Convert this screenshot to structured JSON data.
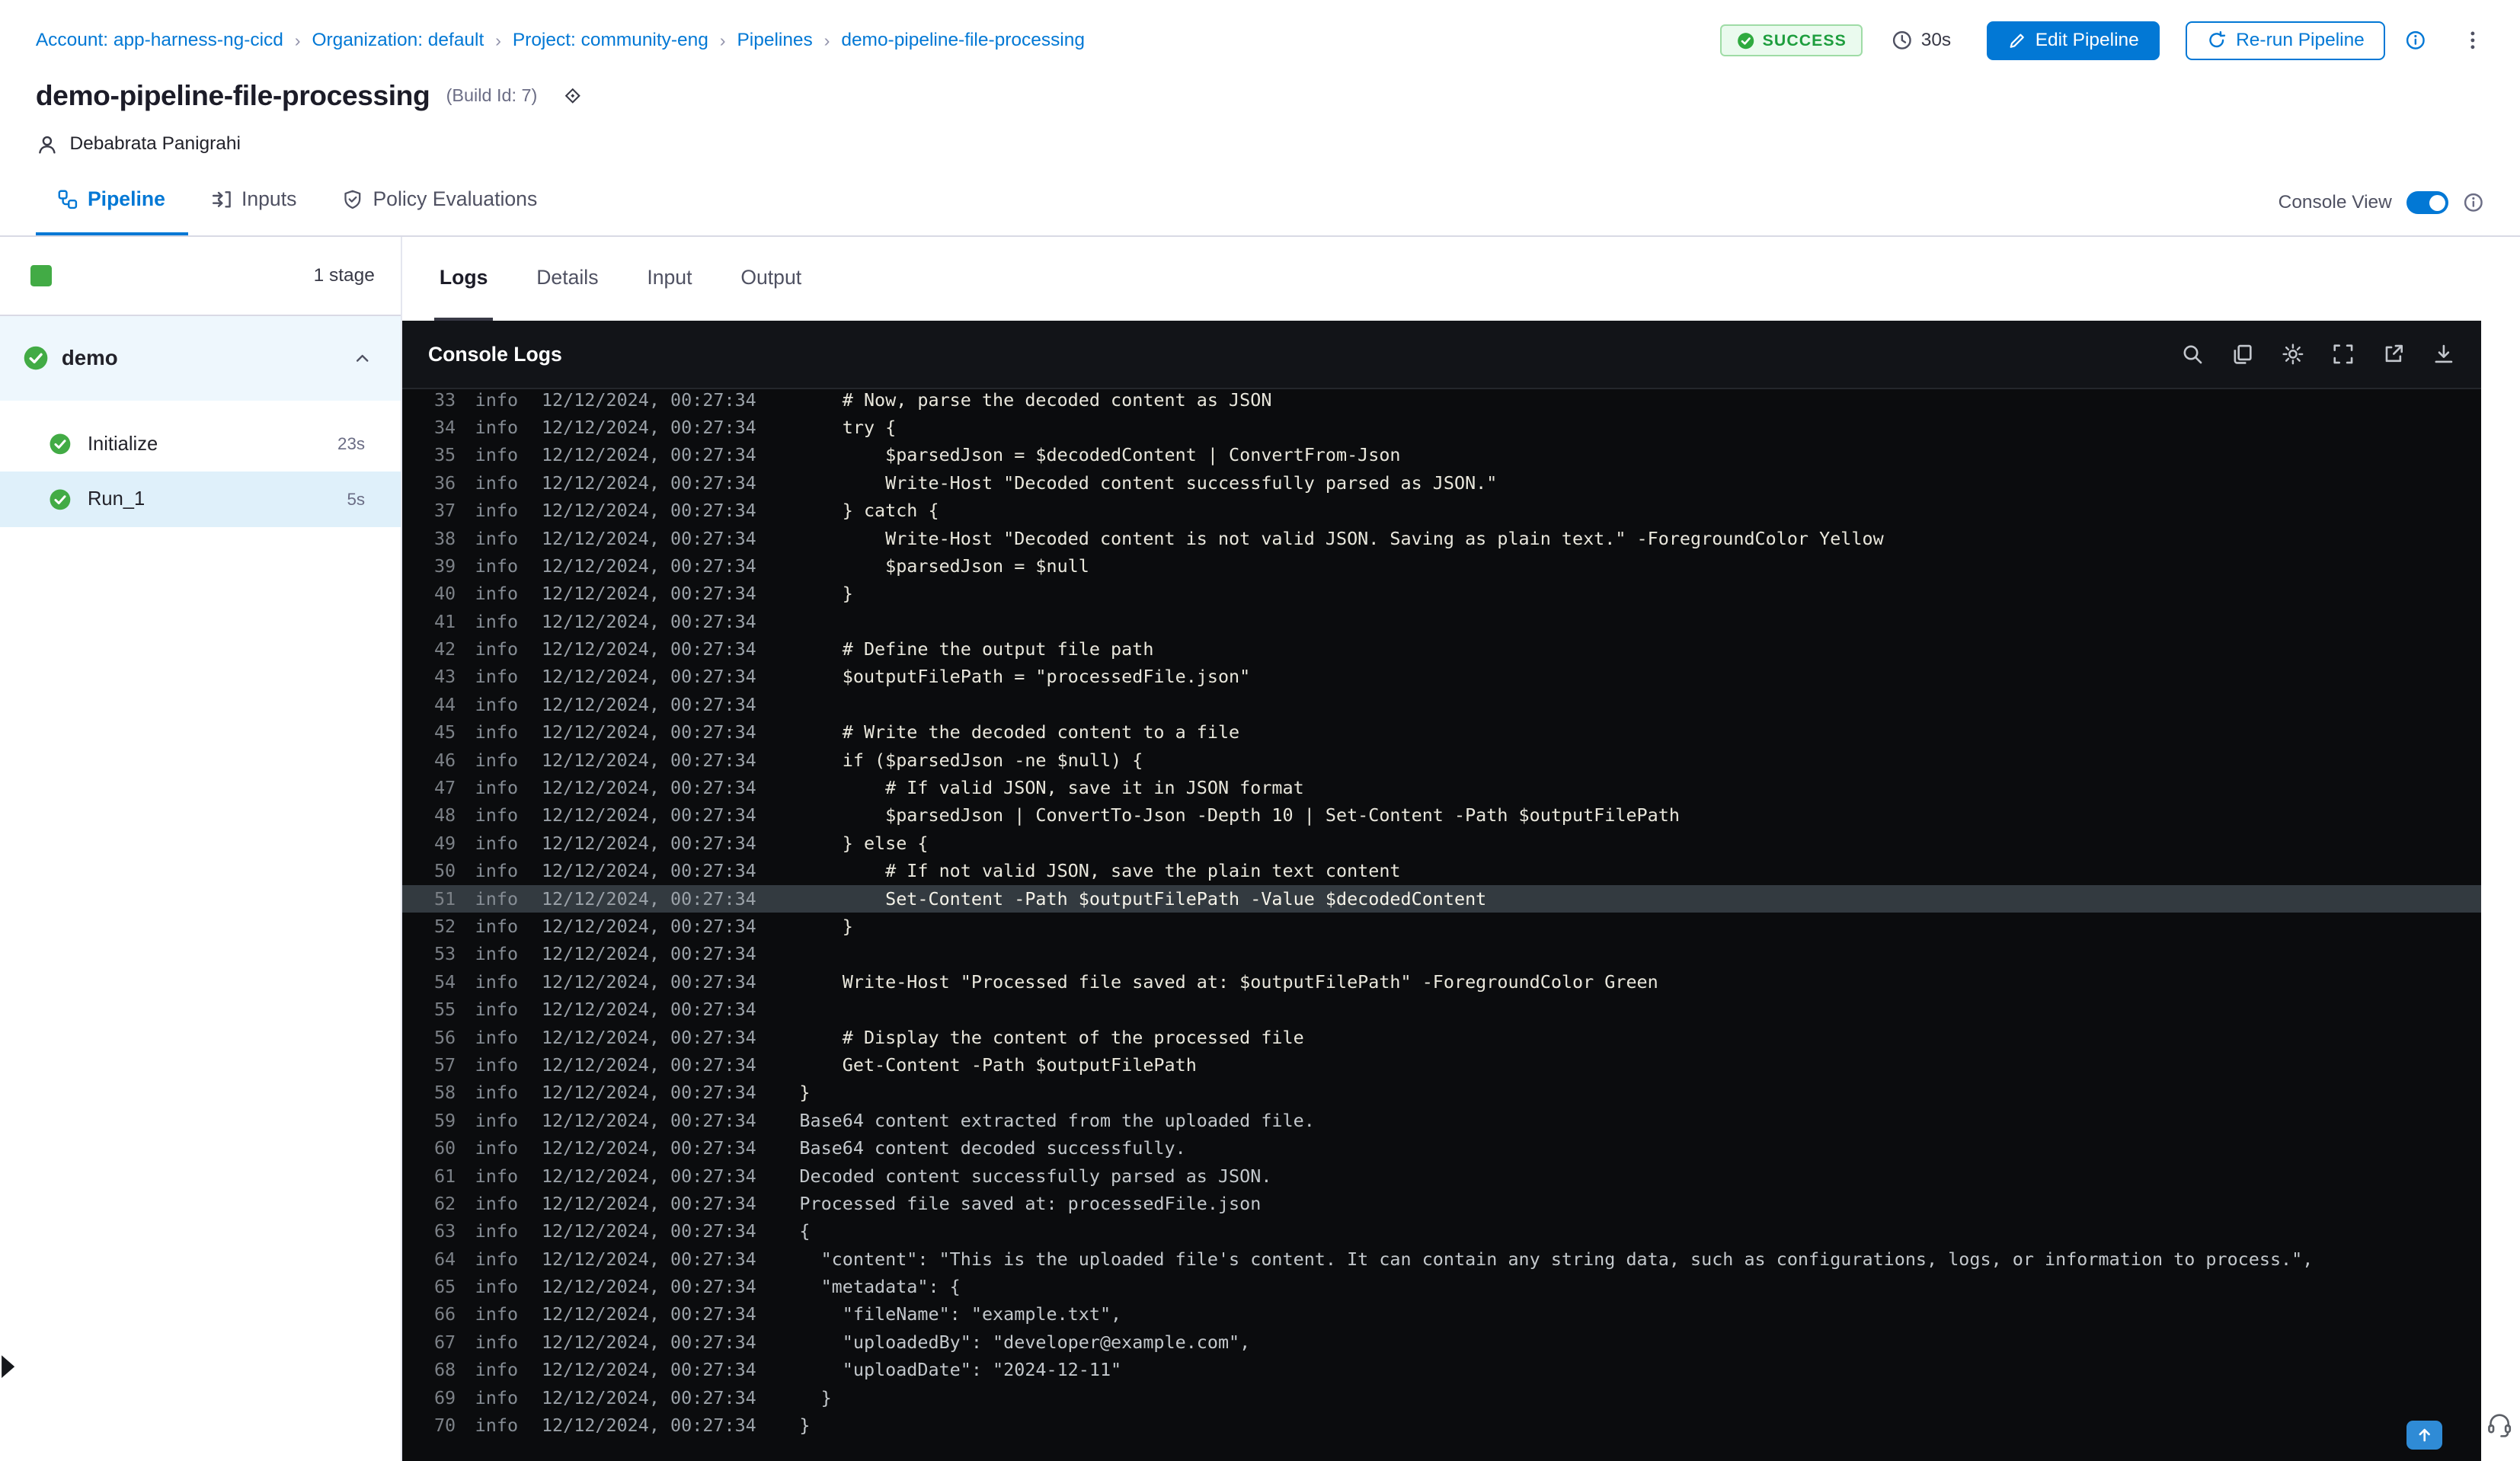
{
  "colors": {
    "accent": "#0278d5",
    "success_green": "#42ab45",
    "console_bg": "#0b0c0e",
    "highlight_row": "#333a40"
  },
  "breadcrumb": {
    "separator": "›",
    "items": [
      "Account: app-harness-ng-cicd",
      "Organization: default",
      "Project: community-eng",
      "Pipelines",
      "demo-pipeline-file-processing"
    ]
  },
  "header": {
    "status": "SUCCESS",
    "duration": "30s",
    "edit_button": "Edit Pipeline",
    "rerun_button": "Re-run Pipeline",
    "title": "demo-pipeline-file-processing",
    "build_id": "(Build Id: 7)",
    "user": "Debabrata Panigrahi"
  },
  "nav_tabs": {
    "items": [
      {
        "label": "Pipeline",
        "active": true
      },
      {
        "label": "Inputs",
        "active": false
      },
      {
        "label": "Policy Evaluations",
        "active": false
      }
    ],
    "console_view_label": "Console View",
    "console_view_on": true
  },
  "sidebar": {
    "stage_count": "1 stage",
    "stage_group": "demo",
    "steps": [
      {
        "name": "Initialize",
        "duration": "23s",
        "selected": false
      },
      {
        "name": "Run_1",
        "duration": "5s",
        "selected": true
      }
    ]
  },
  "log_panel": {
    "tabs": [
      "Logs",
      "Details",
      "Input",
      "Output"
    ],
    "active_tab": "Logs",
    "console_title": "Console Logs",
    "level": "info",
    "timestamp": "12/12/2024, 00:27:34",
    "lines": [
      {
        "n": 33,
        "kind": "script",
        "text": "    # Now, parse the decoded content as JSON"
      },
      {
        "n": 34,
        "kind": "script",
        "text": "    try {"
      },
      {
        "n": 35,
        "kind": "script",
        "text": "        $parsedJson = $decodedContent | ConvertFrom-Json"
      },
      {
        "n": 36,
        "kind": "script",
        "text": "        Write-Host \"Decoded content successfully parsed as JSON.\""
      },
      {
        "n": 37,
        "kind": "script",
        "text": "    } catch {"
      },
      {
        "n": 38,
        "kind": "script",
        "text": "        Write-Host \"Decoded content is not valid JSON. Saving as plain text.\" -ForegroundColor Yellow"
      },
      {
        "n": 39,
        "kind": "script",
        "text": "        $parsedJson = $null"
      },
      {
        "n": 40,
        "kind": "script",
        "text": "    }"
      },
      {
        "n": 41,
        "kind": "script",
        "text": ""
      },
      {
        "n": 42,
        "kind": "script",
        "text": "    # Define the output file path"
      },
      {
        "n": 43,
        "kind": "script",
        "text": "    $outputFilePath = \"processedFile.json\""
      },
      {
        "n": 44,
        "kind": "script",
        "text": ""
      },
      {
        "n": 45,
        "kind": "script",
        "text": "    # Write the decoded content to a file"
      },
      {
        "n": 46,
        "kind": "script",
        "text": "    if ($parsedJson -ne $null) {"
      },
      {
        "n": 47,
        "kind": "script",
        "text": "        # If valid JSON, save it in JSON format"
      },
      {
        "n": 48,
        "kind": "script",
        "text": "        $parsedJson | ConvertTo-Json -Depth 10 | Set-Content -Path $outputFilePath"
      },
      {
        "n": 49,
        "kind": "script",
        "text": "    } else {"
      },
      {
        "n": 50,
        "kind": "script",
        "text": "        # If not valid JSON, save the plain text content"
      },
      {
        "n": 51,
        "kind": "script",
        "highlight": true,
        "text": "        Set-Content -Path $outputFilePath -Value $decodedContent"
      },
      {
        "n": 52,
        "kind": "script",
        "text": "    }"
      },
      {
        "n": 53,
        "kind": "script",
        "text": ""
      },
      {
        "n": 54,
        "kind": "script",
        "text": "    Write-Host \"Processed file saved at: $outputFilePath\" -ForegroundColor Green"
      },
      {
        "n": 55,
        "kind": "script",
        "text": ""
      },
      {
        "n": 56,
        "kind": "script",
        "text": "    # Display the content of the processed file"
      },
      {
        "n": 57,
        "kind": "script",
        "text": "    Get-Content -Path $outputFilePath"
      },
      {
        "n": 58,
        "kind": "script",
        "text": "}"
      },
      {
        "n": 59,
        "kind": "output",
        "text": "Base64 content extracted from the uploaded file."
      },
      {
        "n": 60,
        "kind": "output",
        "text": "Base64 content decoded successfully."
      },
      {
        "n": 61,
        "kind": "output",
        "text": "Decoded content successfully parsed as JSON."
      },
      {
        "n": 62,
        "kind": "output",
        "text": "Processed file saved at: processedFile.json"
      },
      {
        "n": 63,
        "kind": "output",
        "text": "{"
      },
      {
        "n": 64,
        "kind": "output",
        "text": "  \"content\": \"This is the uploaded file's content. It can contain any string data, such as configurations, logs, or information to process.\","
      },
      {
        "n": 65,
        "kind": "output",
        "text": "  \"metadata\": {"
      },
      {
        "n": 66,
        "kind": "output",
        "text": "    \"fileName\": \"example.txt\","
      },
      {
        "n": 67,
        "kind": "output",
        "text": "    \"uploadedBy\": \"developer@example.com\","
      },
      {
        "n": 68,
        "kind": "output",
        "text": "    \"uploadDate\": \"2024-12-11\""
      },
      {
        "n": 69,
        "kind": "output",
        "text": "  }"
      },
      {
        "n": 70,
        "kind": "output",
        "text": "}"
      }
    ]
  },
  "icons": {
    "status_check": "check-circle",
    "clock": "clock",
    "edit": "pencil",
    "rerun": "refresh",
    "info": "info-circle",
    "more": "kebab-vertical",
    "user": "person",
    "tab_pipeline": "pipeline-graph",
    "tab_inputs": "arrows-input",
    "tab_policy": "shield-check",
    "console_search": "magnifier",
    "console_copy": "copy",
    "console_settings": "gear",
    "console_fullscreen": "expand",
    "console_open": "external-link",
    "console_download": "download",
    "scroll_top": "arrow-up",
    "support": "headset",
    "expand_handle": "triangle-right",
    "step_success": "check-circle",
    "collapse": "chevron-up"
  }
}
